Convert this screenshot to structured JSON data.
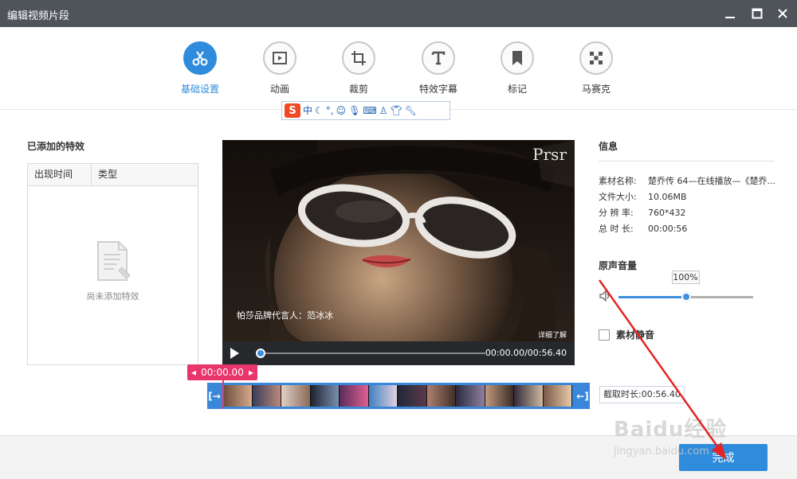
{
  "window": {
    "title": "编辑视频片段"
  },
  "toolbar": {
    "tools": [
      {
        "label": "基础设置",
        "icon": "scissors-icon",
        "active": true
      },
      {
        "label": "动画",
        "icon": "play-frame-icon"
      },
      {
        "label": "裁剪",
        "icon": "crop-icon"
      },
      {
        "label": "特效字幕",
        "icon": "text-t-icon"
      },
      {
        "label": "标记",
        "icon": "bookmark-icon"
      },
      {
        "label": "马赛克",
        "icon": "mosaic-icon"
      }
    ]
  },
  "ime": {
    "logo": "S",
    "mode": "中"
  },
  "effects": {
    "title": "已添加的特效",
    "columns": [
      "出现时间",
      "类型"
    ],
    "empty_text": "尚未添加特效"
  },
  "player": {
    "video_caption": "帕莎品牌代言人：范冰冰",
    "video_logo": "Prsr",
    "video_corner": "详细了解",
    "time": "00:00.00/00:56.40"
  },
  "timeline": {
    "marker_time": "00:00.00",
    "cut_length": "截取时长:00:56.40"
  },
  "info": {
    "title": "信息",
    "rows": [
      {
        "key": "素材名称:",
        "value": "楚乔传 64—在线播放—《楚乔..."
      },
      {
        "key": "文件大小:",
        "value": "10.06MB"
      },
      {
        "key": "分 辨 率:",
        "value": "760*432"
      },
      {
        "key": "总 时 长:",
        "value": "00:00:56"
      }
    ]
  },
  "volume": {
    "title": "原声音量",
    "value": 100,
    "display": "100%",
    "slider_fraction": 0.5,
    "mute_label": "素材静音"
  },
  "footer": {
    "done_label": "完成"
  },
  "watermark": {
    "main": "Baidu经验",
    "sub": "jingyan.baidu.com"
  },
  "colors": {
    "accent": "#2f8bdc",
    "marker": "#e8356b",
    "titlebar": "#4f535a",
    "annotation": "#e42525"
  }
}
